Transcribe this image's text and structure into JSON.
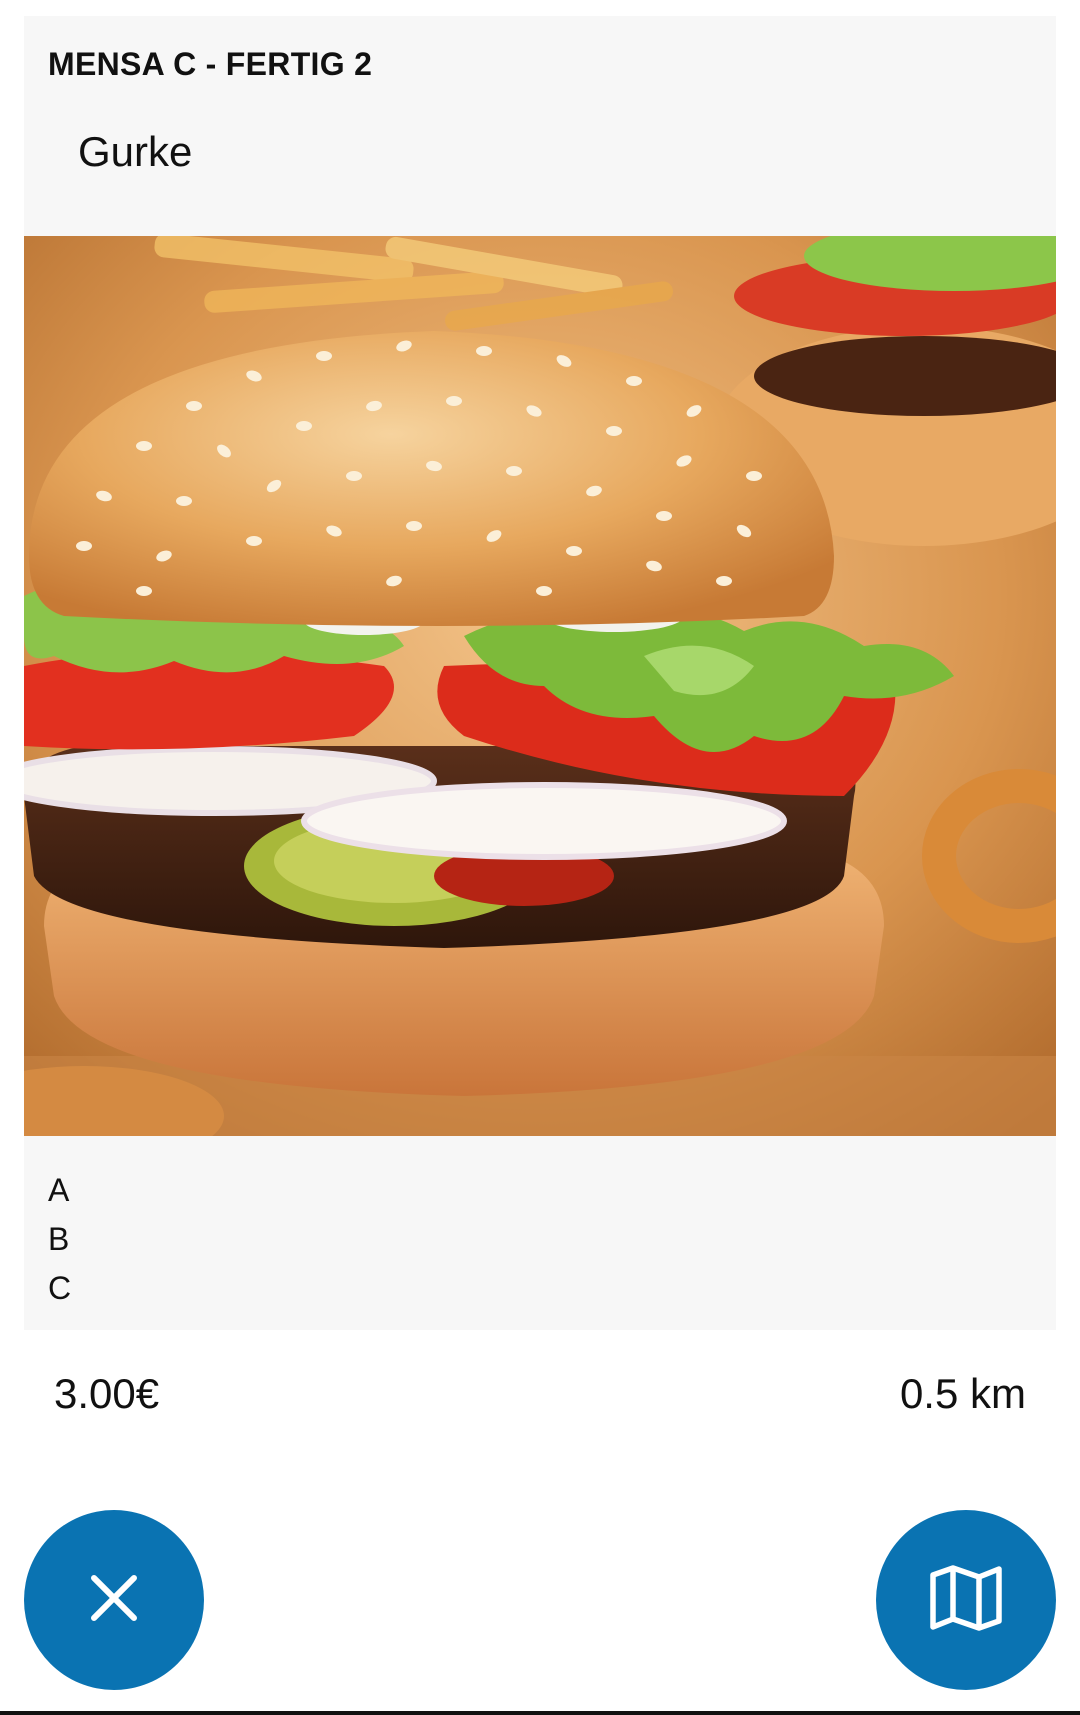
{
  "card": {
    "title": "MENSA C - FERTIG 2",
    "subtitle": "Gurke",
    "allergens": [
      "A",
      "B",
      "C"
    ]
  },
  "footer": {
    "price": "3.00€",
    "distance": "0.5 km"
  },
  "actions": {
    "close_icon": "close-icon",
    "map_icon": "map-icon",
    "button_color": "#0a73b2"
  }
}
